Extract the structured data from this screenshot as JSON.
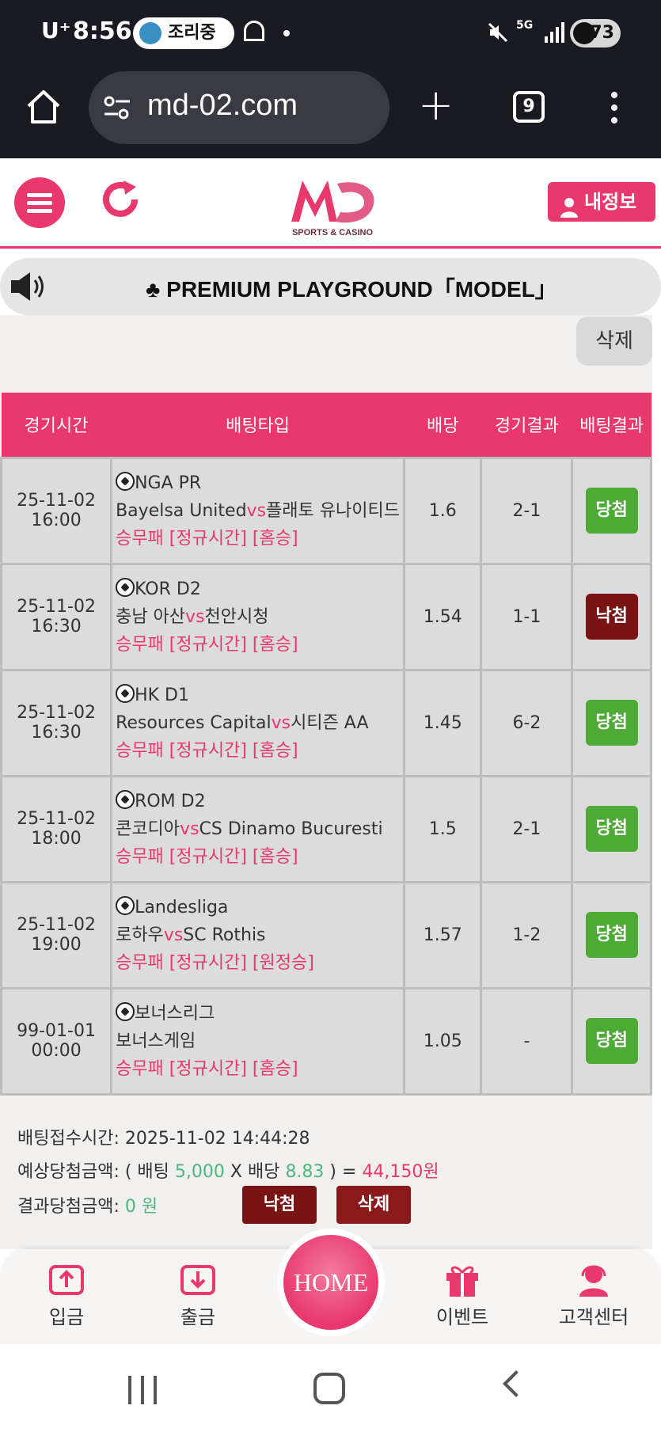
{
  "status_bar": {
    "carrier": "U⁺",
    "time": "8:56",
    "activity_pill": "조리중",
    "network": "5G",
    "battery": "73"
  },
  "browser": {
    "url": "md-02.com",
    "tab_count": "9"
  },
  "header": {
    "logo_sub": "SPORTS & CASINO",
    "myinfo_label": "내정보"
  },
  "notice": {
    "text": "♣ PREMIUM PLAYGROUND「MODEL」"
  },
  "delete_top_label": "삭제",
  "table": {
    "headers": [
      "경기시간",
      "배팅타입",
      "배당",
      "경기결과",
      "배팅결과"
    ],
    "rows": [
      {
        "date": "25-11-02",
        "time": "16:00",
        "league": "NGA PR",
        "home": "Bayelsa United",
        "vs": "vs",
        "away": "플래토 유나이티드",
        "bet_type": "승무패 [정규시간] [홈승]",
        "odds": "1.6",
        "score": "2-1",
        "result": "당첨",
        "result_color": "#4caa35"
      },
      {
        "date": "25-11-02",
        "time": "16:30",
        "league": "KOR D2",
        "home": "충남 아산",
        "vs": "vs",
        "away": "천안시청",
        "bet_type": "승무패 [정규시간] [홈승]",
        "odds": "1.54",
        "score": "1-1",
        "result": "낙첨",
        "result_color": "#7a1414"
      },
      {
        "date": "25-11-02",
        "time": "16:30",
        "league": "HK D1",
        "home": "Resources Capital",
        "vs": "vs",
        "away": "시티즌 AA",
        "bet_type": "승무패 [정규시간] [홈승]",
        "odds": "1.45",
        "score": "6-2",
        "result": "당첨",
        "result_color": "#4caa35"
      },
      {
        "date": "25-11-02",
        "time": "18:00",
        "league": "ROM D2",
        "home": "콘코디아",
        "vs": "vs",
        "away": "CS Dinamo Bucuresti",
        "bet_type": "승무패 [정규시간] [홈승]",
        "odds": "1.5",
        "score": "2-1",
        "result": "당첨",
        "result_color": "#4caa35"
      },
      {
        "date": "25-11-02",
        "time": "19:00",
        "league": "Landesliga",
        "home": "로하우",
        "vs": "vs",
        "away": "SC Rothis",
        "bet_type": "승무패 [정규시간] [원정승]",
        "odds": "1.57",
        "score": "1-2",
        "result": "당첨",
        "result_color": "#4caa35"
      },
      {
        "date": "99-01-01",
        "time": "00:00",
        "league": "보너스리그",
        "home": "보너스게임",
        "vs": "",
        "away": "",
        "bet_type": "승무패 [정규시간] [홈승]",
        "odds": "1.05",
        "score": "-",
        "result": "당첨",
        "result_color": "#4caa35"
      }
    ]
  },
  "summary": {
    "accept_label": "배팅접수시간:",
    "accept_time": "2025-11-02 14:44:28",
    "expected_label": "예상당첨금액: ( 배팅",
    "bet_amount": "5,000",
    "x_label": "X 배당",
    "total_odds": "8.83",
    "eq_label": ") =",
    "expected_amount": "44,150원",
    "result_label": "결과당첨금액:",
    "result_amount": "0",
    "result_unit": "원",
    "lost_button": "낙첨",
    "delete_button": "삭제"
  },
  "bottom_nav": {
    "deposit": "입금",
    "withdraw": "출금",
    "home": "HOME",
    "event": "이벤트",
    "support": "고객센터"
  },
  "colors": {
    "brand_pink": "#e8386c",
    "win_green": "#4caa35",
    "lose_maroon": "#7a1414"
  }
}
